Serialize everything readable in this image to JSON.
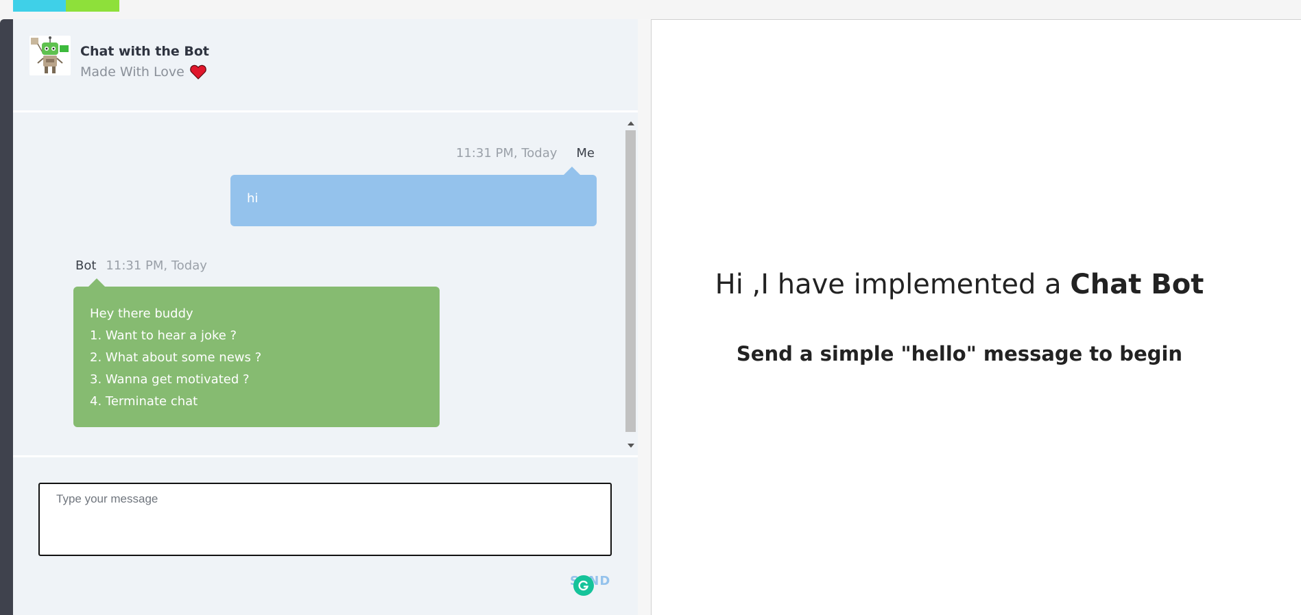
{
  "header": {
    "title": "Chat with the Bot",
    "subtitle": "Made With Love",
    "avatar_icon": "robot-icon",
    "heart_icon": "heart-icon"
  },
  "messages": [
    {
      "sender": "Me",
      "time": "11:31 PM, Today",
      "lines": [
        "hi"
      ]
    },
    {
      "sender": "Bot",
      "time": "11:31 PM, Today",
      "lines": [
        "Hey there buddy",
        "1. Want to hear a joke ?",
        "2. What about some news ?",
        "3. Wanna get motivated ?",
        "4. Terminate chat"
      ]
    }
  ],
  "composer": {
    "placeholder": "Type your message",
    "value": "",
    "send_label": "SEND"
  },
  "intro": {
    "title_prefix": "Hi ,I have implemented a ",
    "title_bold": "Chat Bot",
    "subtitle": "Send a simple \"hello\" message to begin"
  },
  "colors": {
    "frame": "#3f424d",
    "panel": "#eff3f7",
    "me_bubble": "#94c2ec",
    "bot_bubble": "#86bb71",
    "grammarly": "#15c39a"
  }
}
